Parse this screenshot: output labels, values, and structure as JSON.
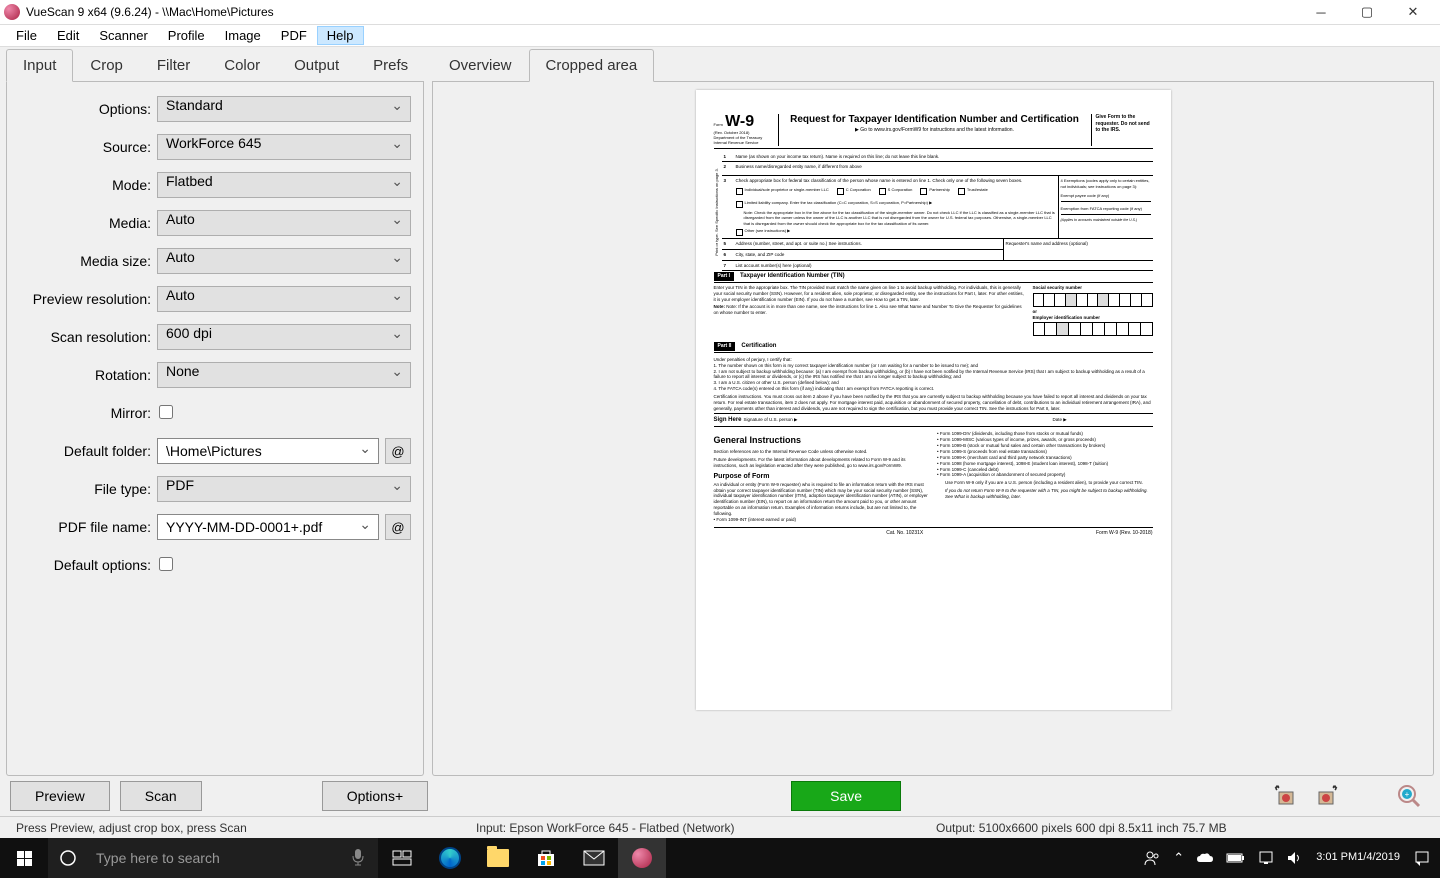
{
  "titlebar": {
    "title": "VueScan 9 x64 (9.6.24) - \\\\Mac\\Home\\Pictures"
  },
  "menubar": {
    "items": [
      "File",
      "Edit",
      "Scanner",
      "Profile",
      "Image",
      "PDF",
      "Help"
    ],
    "active_index": 6
  },
  "left_tabs": {
    "items": [
      "Input",
      "Crop",
      "Filter",
      "Color",
      "Output",
      "Prefs"
    ],
    "active_index": 0
  },
  "right_tabs": {
    "items": [
      "Overview",
      "Cropped area"
    ],
    "active_index": 1
  },
  "form": {
    "options": {
      "label": "Options:",
      "value": "Standard"
    },
    "source": {
      "label": "Source:",
      "value": "WorkForce 645"
    },
    "mode": {
      "label": "Mode:",
      "value": "Flatbed"
    },
    "media": {
      "label": "Media:",
      "value": "Auto"
    },
    "media_size": {
      "label": "Media size:",
      "value": "Auto"
    },
    "preview_res": {
      "label": "Preview resolution:",
      "value": "Auto"
    },
    "scan_res": {
      "label": "Scan resolution:",
      "value": "600 dpi"
    },
    "rotation": {
      "label": "Rotation:",
      "value": "None"
    },
    "mirror": {
      "label": "Mirror:",
      "checked": false
    },
    "default_folder": {
      "label": "Default folder:",
      "value": "\\Home\\Pictures"
    },
    "file_type": {
      "label": "File type:",
      "value": "PDF"
    },
    "pdf_file": {
      "label": "PDF file name:",
      "value": "YYYY-MM-DD-0001+.pdf"
    },
    "default_options": {
      "label": "Default options:",
      "checked": false
    },
    "at_symbol": "@"
  },
  "buttons": {
    "preview": "Preview",
    "scan": "Scan",
    "options_plus": "Options+",
    "save": "Save"
  },
  "statusbar": {
    "left": "Press Preview, adjust crop box, press Scan",
    "center": "Input: Epson WorkForce 645 - Flatbed (Network)",
    "right": "Output: 5100x6600 pixels 600 dpi 8.5x11 inch 75.7 MB"
  },
  "taskbar": {
    "search_placeholder": "Type here to search",
    "time": "3:01 PM",
    "date": "1/4/2019"
  },
  "document": {
    "form_label": "Form",
    "form_name": "W-9",
    "rev": "(Rev. October 2018)",
    "dept": "Department of the Treasury Internal Revenue Service",
    "title": "Request for Taxpayer Identification Number and Certification",
    "inst": "▶ Go to www.irs.gov/FormW9 for instructions and the latest information.",
    "give": "Give Form to the requester. Do not send to the IRS.",
    "row1": "Name (as shown on your income tax return). Name is required on this line; do not leave this line blank.",
    "row2": "Business name/disregarded entity name, if different from above",
    "row3": "Check appropriate box for federal tax classification of the person whose name is entered on line 1. Check only one of the following seven boxes.",
    "cb1": "Individual/sole proprietor or single-member LLC",
    "cb2": "C Corporation",
    "cb3": "S Corporation",
    "cb4": "Partnership",
    "cb5": "Trust/estate",
    "cb6": "Limited liability company. Enter the tax classification (C=C corporation, S=S corporation, P=Partnership) ▶",
    "note3": "Note: Check the appropriate box in the line above for the tax classification of the single-member owner. Do not check LLC if the LLC is classified as a single-member LLC that is disregarded from the owner unless the owner of the LLC is another LLC that is not disregarded from the owner for U.S. federal tax purposes. Otherwise, a single-member LLC that is disregarded from the owner should check the appropriate box for the tax classification of its owner.",
    "cb7": "Other (see instructions) ▶",
    "row4_label": "4  Exemptions (codes apply only to certain entities, not individuals; see instructions on page 3):",
    "payee_code": "Exempt payee code (if any)",
    "fatca": "Exemption from FATCA reporting code (if any)",
    "applies": "(Applies to accounts maintained outside the U.S.)",
    "row5": "Address (number, street, and apt. or suite no.) See instructions.",
    "row5b": "Requester's name and address (optional)",
    "row6": "City, state, and ZIP code",
    "row7": "List account number(s) here (optional)",
    "part1": "Part I",
    "part1_title": "Taxpayer Identification Number (TIN)",
    "part1_text": "Enter your TIN in the appropriate box. The TIN provided must match the name given on line 1 to avoid backup withholding. For individuals, this is generally your social security number (SSN). However, for a resident alien, sole proprietor, or disregarded entity, see the instructions for Part I, later. For other entities, it is your employer identification number (EIN). If you do not have a number, see How to get a TIN, later.",
    "part1_note": "Note: If the account is in more than one name, see the instructions for line 1. Also see What Name and Number To Give the Requester for guidelines on whose number to enter.",
    "ssn_label": "Social security number",
    "or": "or",
    "ein_label": "Employer identification number",
    "part2": "Part II",
    "part2_title": "Certification",
    "part2_lead": "Under penalties of perjury, I certify that:",
    "cert1": "1. The number shown on this form is my correct taxpayer identification number (or I am waiting for a number to be issued to me); and",
    "cert2": "2. I am not subject to backup withholding because: (a) I am exempt from backup withholding, or (b) I have not been notified by the Internal Revenue Service (IRS) that I am subject to backup withholding as a result of a failure to report all interest or dividends, or (c) the IRS has notified me that I am no longer subject to backup withholding; and",
    "cert3": "3. I am a U.S. citizen or other U.S. person (defined below); and",
    "cert4": "4. The FATCA code(s) entered on this form (if any) indicating that I am exempt from FATCA reporting is correct.",
    "cert_inst": "Certification instructions. You must cross out item 2 above if you have been notified by the IRS that you are currently subject to backup withholding because you have failed to report all interest and dividends on your tax return. For real estate transactions, item 2 does not apply. For mortgage interest paid, acquisition or abandonment of secured property, cancellation of debt, contributions to an individual retirement arrangement (IRA), and generally, payments other than interest and dividends, you are not required to sign the certification, but you must provide your correct TIN. See the instructions for Part II, later.",
    "sign": "Sign Here",
    "sig": "Signature of U.S. person ▶",
    "date": "Date ▶",
    "gen_inst": "General Instructions",
    "sec_ref": "Section references are to the Internal Revenue Code unless otherwise noted.",
    "future": "Future developments. For the latest information about developments related to Form W-9 and its instructions, such as legislation enacted after they were published, go to www.irs.gov/FormW9.",
    "purpose": "Purpose of Form",
    "purpose_text": "An individual or entity (Form W-9 requester) who is required to file an information return with the IRS must obtain your correct taxpayer identification number (TIN) which may be your social security number (SSN), individual taxpayer identification number (ITIN), adoption taxpayer identification number (ATIN), or employer identification number (EIN), to report on an information return the amount paid to you, or other amount reportable on an information return. Examples of information returns include, but are not limited to, the following.",
    "b1": "• Form 1099-INT (interest earned or paid)",
    "b2": "• Form 1099-DIV (dividends, including those from stocks or mutual funds)",
    "b3": "• Form 1099-MISC (various types of income, prizes, awards, or gross proceeds)",
    "b4": "• Form 1099-B (stock or mutual fund sales and certain other transactions by brokers)",
    "b5": "• Form 1099-S (proceeds from real estate transactions)",
    "b6": "• Form 1099-K (merchant card and third party network transactions)",
    "b7": "• Form 1098 (home mortgage interest), 1098-E (student loan interest), 1098-T (tuition)",
    "b8": "• Form 1099-C (canceled debt)",
    "b9": "• Form 1099-A (acquisition or abandonment of secured property)",
    "use": "Use Form W-9 only if you are a U.S. person (including a resident alien), to provide your correct TIN.",
    "ifnot": "If you do not return Form W-9 to the requester with a TIN, you might be subject to backup withholding. See What is backup withholding, later.",
    "cat": "Cat. No. 10231X",
    "footer": "Form W-9 (Rev. 10-2018)"
  }
}
